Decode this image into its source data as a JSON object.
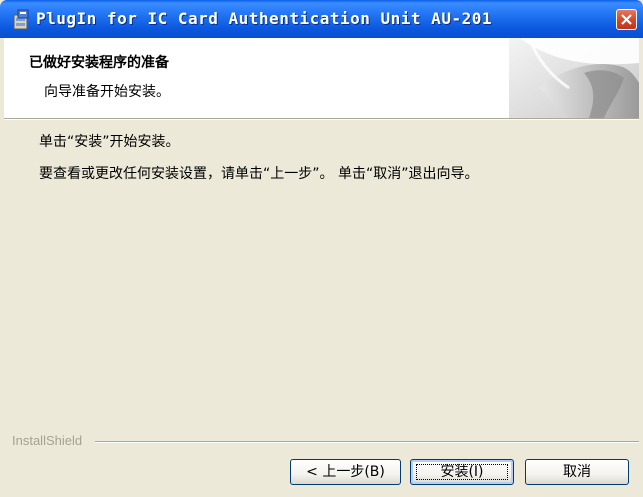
{
  "window": {
    "title": "PlugIn for IC Card Authentication Unit AU-201",
    "title_bar_color": "#0a5fe8",
    "close_button_color": "#d54a2a",
    "icon": "installer-app-icon"
  },
  "header": {
    "title": "已做好安装程序的准备",
    "subtitle": "向导准备开始安装。",
    "art": "decorative-corner-art"
  },
  "body": {
    "line1": "单击“安装”开始安装。",
    "line2": "要查看或更改任何安装设置，请单击“上一步”。 单击“取消”退出向导。"
  },
  "footer": {
    "brand": "InstallShield"
  },
  "buttons": {
    "back_label": "< 上一步(B)",
    "install_label": "安装(I)",
    "cancel_label": "取消"
  }
}
